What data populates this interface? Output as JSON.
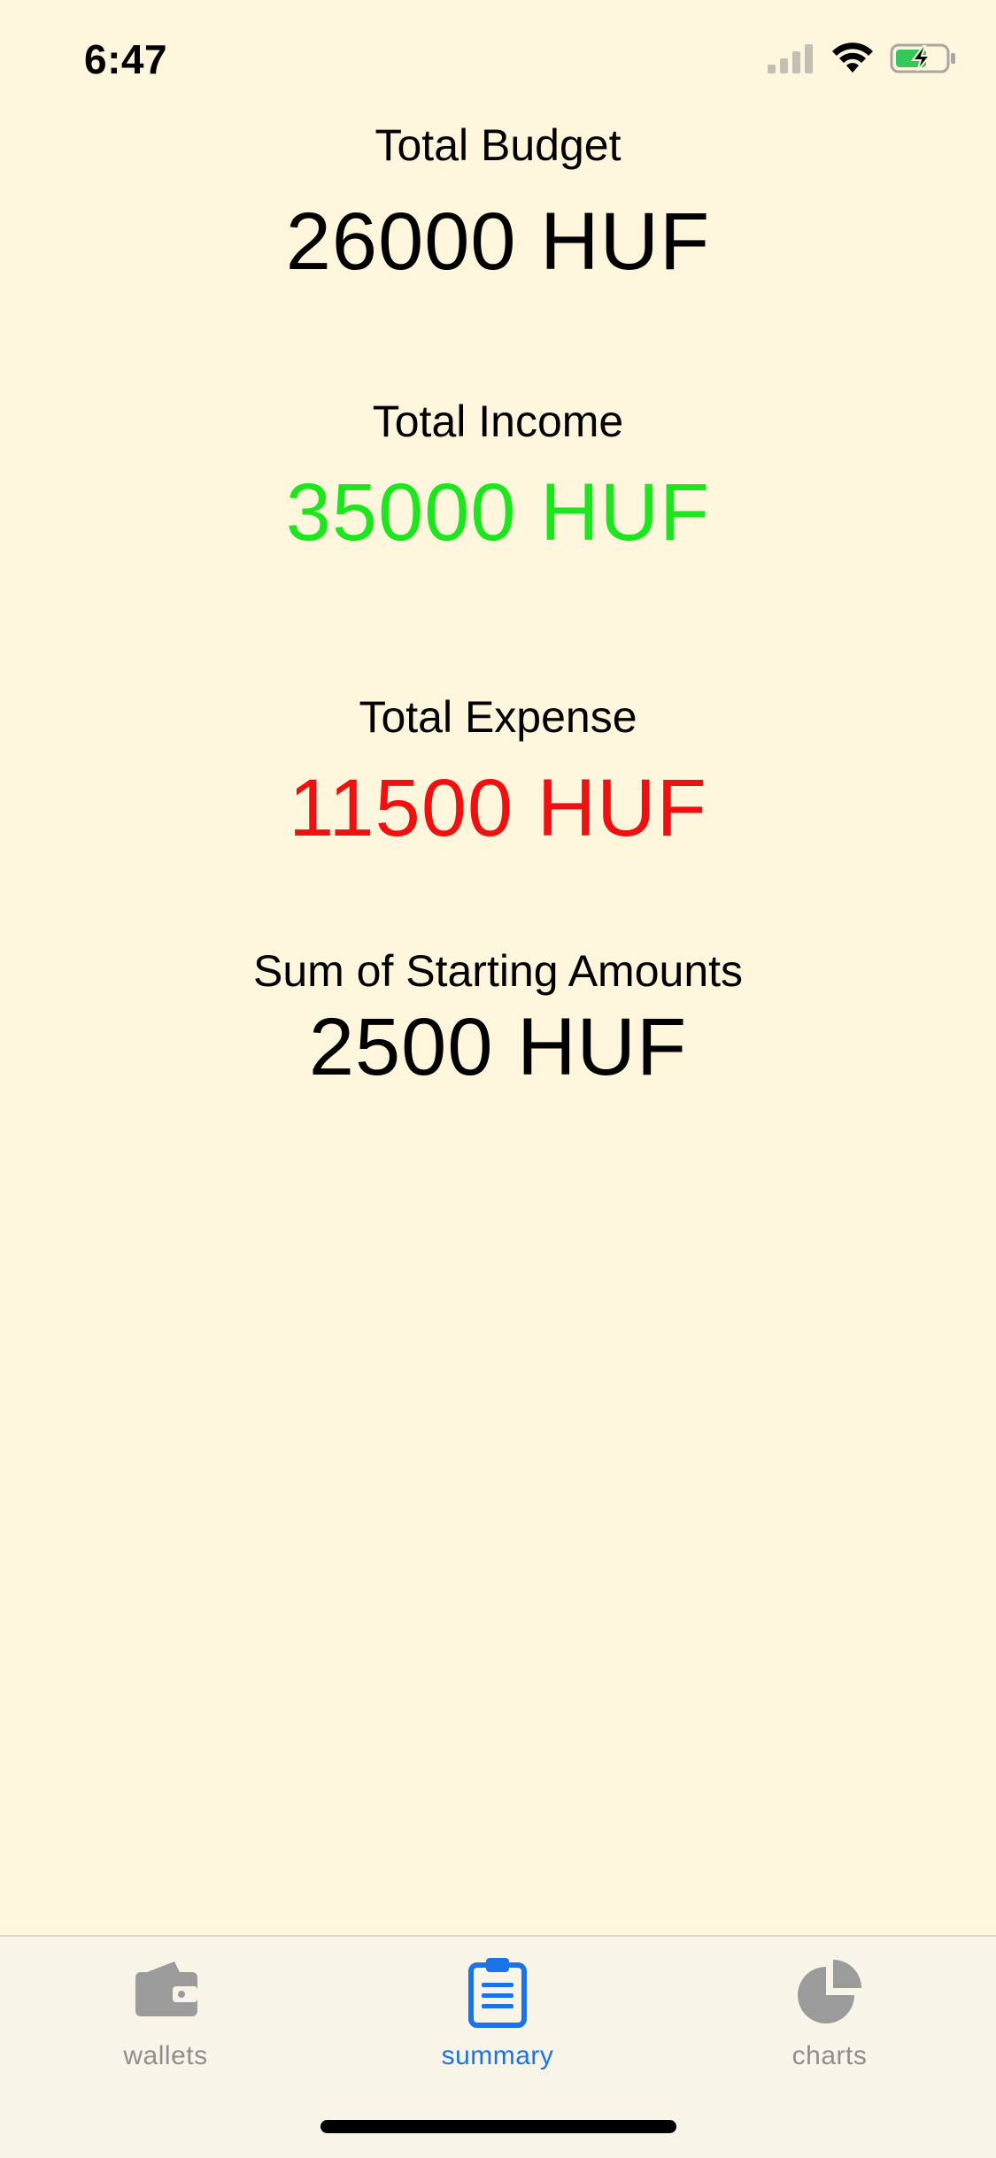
{
  "status_bar": {
    "time": "6:47"
  },
  "summary": {
    "total_budget": {
      "label": "Total Budget",
      "value": "26000 HUF",
      "color": "#000000"
    },
    "total_income": {
      "label": "Total Income",
      "value": "35000 HUF",
      "color": "#1ee61e"
    },
    "total_expense": {
      "label": "Total Expense",
      "value": "11500 HUF",
      "color": "#ee1111"
    },
    "starting_amounts": {
      "label": "Sum of Starting Amounts",
      "value": "2500 HUF",
      "color": "#000000"
    }
  },
  "tab_bar": {
    "tabs": [
      {
        "label": "wallets",
        "icon": "wallet-icon",
        "active": false
      },
      {
        "label": "summary",
        "icon": "clipboard-icon",
        "active": true
      },
      {
        "label": "charts",
        "icon": "pie-chart-icon",
        "active": false
      }
    ],
    "active_color": "#1a73e8",
    "inactive_color": "#8e8e8e"
  },
  "colors": {
    "background": "#fdf6dc"
  }
}
